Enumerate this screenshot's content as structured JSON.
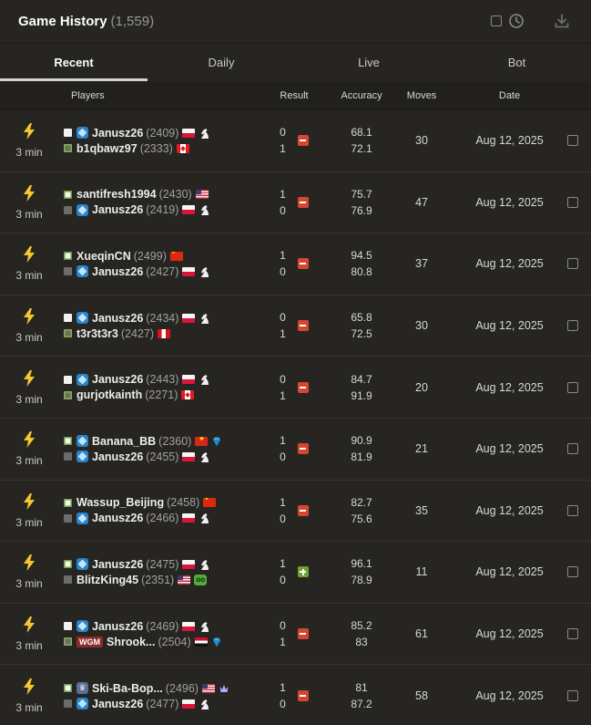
{
  "header": {
    "title": "Game History",
    "count": "(1,559)"
  },
  "tabs": [
    {
      "label": "Recent",
      "active": true
    },
    {
      "label": "Daily",
      "active": false
    },
    {
      "label": "Live",
      "active": false
    },
    {
      "label": "Bot",
      "active": false
    }
  ],
  "columns": {
    "players": "Players",
    "result": "Result",
    "accuracy": "Accuracy",
    "moves": "Moves",
    "date": "Date"
  },
  "colors": {
    "background": "#262522",
    "loss": "#d64533",
    "win": "#6fa234",
    "bolt": "#f7c631",
    "membership_diamond": "#2b83c8"
  },
  "games": [
    {
      "time_control": "3 min",
      "icon": "bolt-icon",
      "white": {
        "name": "Janusz26",
        "rating": "(2409)",
        "badge": "diamond",
        "flag": "PL",
        "extra": "knight"
      },
      "black": {
        "name": "b1qbawz97",
        "rating": "(2333)",
        "badge": "",
        "flag": "CA",
        "extra": "",
        "winner": true
      },
      "score_white": "0",
      "score_black": "1",
      "outcome": "loss",
      "accuracy_white": "68.1",
      "accuracy_black": "72.1",
      "moves": "30",
      "date": "Aug 12, 2025"
    },
    {
      "time_control": "3 min",
      "icon": "bolt-icon",
      "white": {
        "name": "santifresh1994",
        "rating": "(2430)",
        "badge": "",
        "flag": "US",
        "extra": "",
        "winner": true
      },
      "black": {
        "name": "Janusz26",
        "rating": "(2419)",
        "badge": "diamond",
        "flag": "PL",
        "extra": "knight"
      },
      "score_white": "1",
      "score_black": "0",
      "outcome": "loss",
      "accuracy_white": "75.7",
      "accuracy_black": "76.9",
      "moves": "47",
      "date": "Aug 12, 2025"
    },
    {
      "time_control": "3 min",
      "icon": "bolt-icon",
      "white": {
        "name": "XueqinCN",
        "rating": "(2499)",
        "badge": "",
        "flag": "CN",
        "extra": "",
        "winner": true
      },
      "black": {
        "name": "Janusz26",
        "rating": "(2427)",
        "badge": "diamond",
        "flag": "PL",
        "extra": "knight"
      },
      "score_white": "1",
      "score_black": "0",
      "outcome": "loss",
      "accuracy_white": "94.5",
      "accuracy_black": "80.8",
      "moves": "37",
      "date": "Aug 12, 2025"
    },
    {
      "time_control": "3 min",
      "icon": "bolt-icon",
      "white": {
        "name": "Janusz26",
        "rating": "(2434)",
        "badge": "diamond",
        "flag": "PL",
        "extra": "knight"
      },
      "black": {
        "name": "t3r3t3r3",
        "rating": "(2427)",
        "badge": "",
        "flag": "PE",
        "extra": "",
        "winner": true
      },
      "score_white": "0",
      "score_black": "1",
      "outcome": "loss",
      "accuracy_white": "65.8",
      "accuracy_black": "72.5",
      "moves": "30",
      "date": "Aug 12, 2025"
    },
    {
      "time_control": "3 min",
      "icon": "bolt-icon",
      "white": {
        "name": "Janusz26",
        "rating": "(2443)",
        "badge": "diamond",
        "flag": "PL",
        "extra": "knight"
      },
      "black": {
        "name": "gurjotkainth",
        "rating": "(2271)",
        "badge": "",
        "flag": "CA",
        "extra": "",
        "winner": true
      },
      "score_white": "0",
      "score_black": "1",
      "outcome": "loss",
      "accuracy_white": "84.7",
      "accuracy_black": "91.9",
      "moves": "20",
      "date": "Aug 12, 2025"
    },
    {
      "time_control": "3 min",
      "icon": "bolt-icon",
      "white": {
        "name": "Banana_BB",
        "rating": "(2360)",
        "badge": "diamond",
        "flag": "VN",
        "extra": "gem",
        "winner": true
      },
      "black": {
        "name": "Janusz26",
        "rating": "(2455)",
        "badge": "diamond",
        "flag": "PL",
        "extra": "knight"
      },
      "score_white": "1",
      "score_black": "0",
      "outcome": "loss",
      "accuracy_white": "90.9",
      "accuracy_black": "81.9",
      "moves": "21",
      "date": "Aug 12, 2025"
    },
    {
      "time_control": "3 min",
      "icon": "bolt-icon",
      "white": {
        "name": "Wassup_Beijing",
        "rating": "(2458)",
        "badge": "",
        "flag": "CN",
        "extra": "",
        "winner": true
      },
      "black": {
        "name": "Janusz26",
        "rating": "(2466)",
        "badge": "diamond",
        "flag": "PL",
        "extra": "knight"
      },
      "score_white": "1",
      "score_black": "0",
      "outcome": "loss",
      "accuracy_white": "82.7",
      "accuracy_black": "75.6",
      "moves": "35",
      "date": "Aug 12, 2025"
    },
    {
      "time_control": "3 min",
      "icon": "bolt-icon",
      "white": {
        "name": "Janusz26",
        "rating": "(2475)",
        "badge": "diamond",
        "flag": "PL",
        "extra": "knight",
        "winner": true
      },
      "black": {
        "name": "BlitzKing45",
        "rating": "(2351)",
        "badge": "",
        "flag": "US",
        "extra": "glasses"
      },
      "score_white": "1",
      "score_black": "0",
      "outcome": "win",
      "accuracy_white": "96.1",
      "accuracy_black": "78.9",
      "moves": "11",
      "date": "Aug 12, 2025"
    },
    {
      "time_control": "3 min",
      "icon": "bolt-icon",
      "white": {
        "name": "Janusz26",
        "rating": "(2469)",
        "badge": "diamond",
        "flag": "PL",
        "extra": "knight"
      },
      "black": {
        "name": "Shrook...",
        "rating": "(2504)",
        "badge": "WGM",
        "flag": "EG",
        "extra": "gem",
        "winner": true
      },
      "score_white": "0",
      "score_black": "1",
      "outcome": "loss",
      "accuracy_white": "85.2",
      "accuracy_black": "83",
      "moves": "61",
      "date": "Aug 12, 2025"
    },
    {
      "time_control": "3 min",
      "icon": "bolt-icon",
      "white": {
        "name": "Ski-Ba-Bop...",
        "rating": "(2496)",
        "badge": "crown",
        "flag": "US",
        "extra": "crown-gem",
        "winner": true
      },
      "black": {
        "name": "Janusz26",
        "rating": "(2477)",
        "badge": "diamond",
        "flag": "PL",
        "extra": "knight"
      },
      "score_white": "1",
      "score_black": "0",
      "outcome": "loss",
      "accuracy_white": "81",
      "accuracy_black": "87.2",
      "moves": "58",
      "date": "Aug 12, 2025"
    }
  ]
}
